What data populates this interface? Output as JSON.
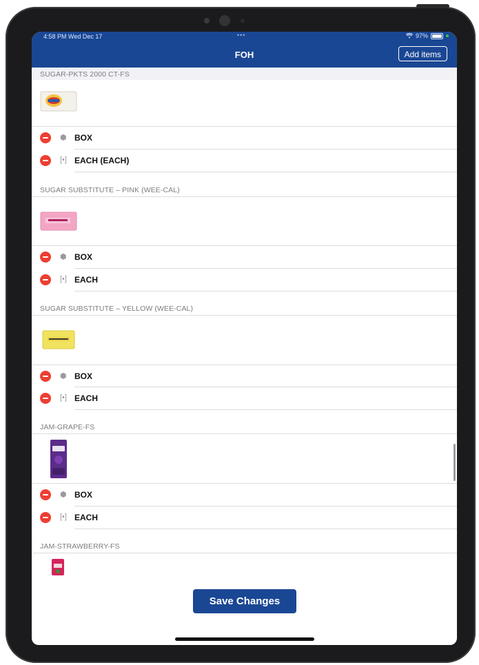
{
  "status_bar": {
    "time": "4:58 PM  Wed Dec 17",
    "dots": "•••",
    "battery": "97%",
    "battery_level": 0.97
  },
  "nav": {
    "title": "FOH",
    "add_items_label": "Add items"
  },
  "sections": [
    {
      "header": "SUGAR-PKTS 2000 CT-FS",
      "image": "sugar-packet-burger-king",
      "rows": [
        {
          "icon": "box-icon",
          "label": "BOX"
        },
        {
          "icon": "each-icon",
          "label": "EACH (EACH)"
        }
      ]
    },
    {
      "header": "SUGAR SUBSTITUTE – PINK (WEE-CAL)",
      "image": "sweet-n-low-packet",
      "rows": [
        {
          "icon": "box-icon",
          "label": "BOX"
        },
        {
          "icon": "each-icon",
          "label": "EACH"
        }
      ]
    },
    {
      "header": "SUGAR SUBSTITUTE – YELLOW (WEE-CAL)",
      "image": "splenda-packet",
      "rows": [
        {
          "icon": "box-icon",
          "label": "BOX"
        },
        {
          "icon": "each-icon",
          "label": "EACH"
        }
      ]
    },
    {
      "header": "JAM-GRAPE-FS",
      "image": "grape-jam-packet",
      "rows": [
        {
          "icon": "box-icon",
          "label": "BOX"
        },
        {
          "icon": "each-icon",
          "label": "EACH"
        }
      ]
    },
    {
      "header": "JAM-STRAWBERRY-FS",
      "image": "strawberry-jam-packet",
      "rows": []
    }
  ],
  "icons": {
    "box": "⬢",
    "each": "[•]"
  },
  "footer": {
    "save_label": "Save Changes"
  },
  "colors": {
    "nav_blue": "#1a4794",
    "delete_red": "#ee3e32",
    "section_text": "#7c7c82"
  }
}
